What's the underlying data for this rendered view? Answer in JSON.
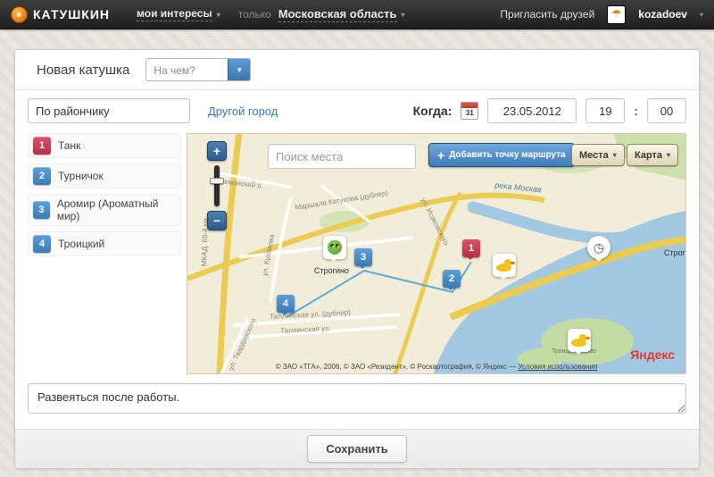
{
  "colors": {
    "accent_blue": "#3b7cb8",
    "marker_red": "#b92e47",
    "marker_blue": "#3b7cb8",
    "yandex_red": "#e8372d",
    "map_water": "#a3c9e2",
    "map_land": "#f1edd8"
  },
  "topbar": {
    "brand": "КАТУШКИН",
    "menu_interests": "мои интересы",
    "only_label": "только",
    "region": "Московская область",
    "invite": "Пригласить друзей",
    "username": "kozadoev",
    "avatar_icon": "umbrella-icon",
    "caret_icon": "▾"
  },
  "form": {
    "title": "Новая катушка",
    "transport_placeholder": "На чем?",
    "district_value": "По райончику",
    "other_city_link": "Другой город",
    "when_label": "Когда:",
    "calendar_day": "31",
    "date_value": "23.05.2012",
    "hour_value": "19",
    "time_separator": ":",
    "minute_value": "00",
    "comment_value": "Развеяться после работы.",
    "save_button": "Сохранить"
  },
  "route": {
    "items": [
      {
        "num": "1",
        "label": "Танк",
        "color": "#b92e47"
      },
      {
        "num": "2",
        "label": "Турничок",
        "color": "#3b7cb8"
      },
      {
        "num": "3",
        "label": "Аромир (Ароматный мир)",
        "color": "#3b7cb8"
      },
      {
        "num": "4",
        "label": "Троицкий",
        "color": "#3b7cb8"
      }
    ]
  },
  "map": {
    "zoom_in": "+",
    "zoom_out": "−",
    "search_placeholder": "Поиск места",
    "add_point_button": "Добавить точку маршрута",
    "add_point_plus": "+",
    "places_button": "Места",
    "layer_button": "Карта",
    "copyright": "© ЗАО «ТГА», 2006, © ЗАО «Резидент», © Роскартография, © Яндекс —",
    "terms_link": "Условия использования",
    "yandex_logo": "Яндекс",
    "gauge_glyph": "◷",
    "labels": [
      {
        "text": "МКАД. 65-й км"
      },
      {
        "text": "ул. Кулакова"
      },
      {
        "text": "Маршала Катукова (дублер)"
      },
      {
        "text": "ул. Исаковского"
      },
      {
        "text": "река Москва"
      },
      {
        "text": "Строгино"
      },
      {
        "text": "Таллинская ул. (дублер)"
      },
      {
        "text": "Таллинская ул."
      },
      {
        "text": "ул. Твардовского"
      },
      {
        "text": "Неманский п."
      },
      {
        "text": "Строг"
      },
      {
        "text": "Троице-Лыково"
      }
    ]
  }
}
